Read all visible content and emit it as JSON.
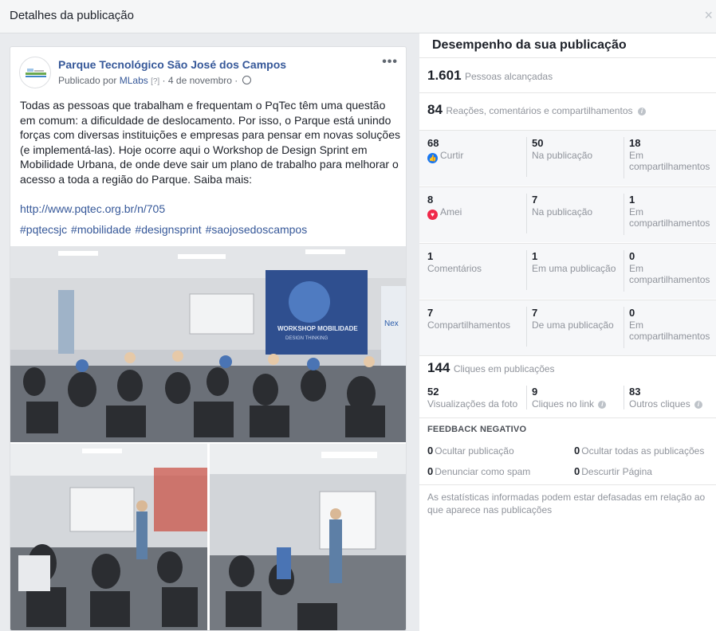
{
  "modal": {
    "title": "Detalhes da publicação",
    "close": "×"
  },
  "post": {
    "page_name": "Parque Tecnológico São José dos Campos",
    "meta_prefix": "Publicado por ",
    "publisher": "MLabs",
    "publisher_note": "[?]",
    "date": " · 4 de novembro · ",
    "more": "•••",
    "text": "Todas as pessoas que trabalham e frequentam o PqTec têm uma questão em comum: a dificuldade de deslocamento. Por isso, o Parque está unindo forças com diversas instituições e empresas para pensar em novas soluções (e implementá-las). Hoje ocorre aqui o Workshop de Design Sprint em Mobilidade Urbana, de onde deve sair um plano de trabalho para melhorar o acesso a toda a região do Parque. Saiba mais:",
    "link": "http://www.pqtec.org.br/n/705",
    "hashtags": "#pqtecsjc #mobilidade #designsprint #saojosedoscampos",
    "screen_text": "WORKSHOP MOBILIDADE",
    "screen_subtext": "DESIGN THINKING",
    "banner_text": "Nex"
  },
  "performance": {
    "title": "Desempenho da sua publicação",
    "reach": {
      "value": "1.601",
      "label": "Pessoas alcançadas"
    },
    "engagement": {
      "value": "84",
      "label": "Reações, comentários e compartilhamentos",
      "info": "i"
    },
    "rows": [
      {
        "total": "68",
        "total_label": "Curtir",
        "icon": "like-icon",
        "a": "50",
        "a_label": "Na publicação",
        "b": "18",
        "b_label": "Em compartilhamentos"
      },
      {
        "total": "8",
        "total_label": "Amei",
        "icon": "love-icon",
        "a": "7",
        "a_label": "Na publicação",
        "b": "1",
        "b_label": "Em compartilhamentos"
      },
      {
        "total": "1",
        "total_label": "Comentários",
        "a": "1",
        "a_label": "Em uma publicação",
        "b": "0",
        "b_label": "Em compartilhamentos"
      },
      {
        "total": "7",
        "total_label": "Compartilhamentos",
        "a": "7",
        "a_label": "De uma publicação",
        "b": "0",
        "b_label": "Em compartilhamentos"
      }
    ],
    "clicks": {
      "value": "144",
      "label": "Cliques em publicações",
      "photo_views": "52",
      "photo_views_label": "Visualizações da foto",
      "link_clicks": "9",
      "link_clicks_label": "Cliques no link",
      "other_clicks": "83",
      "other_clicks_label": "Outros cliques"
    },
    "negative": {
      "title": "FEEDBACK NEGATIVO",
      "hide_post": {
        "value": "0",
        "label": "Ocultar publicação"
      },
      "hide_all": {
        "value": "0",
        "label": "Ocultar todas as publicações"
      },
      "report_spam": {
        "value": "0",
        "label": "Denunciar como spam"
      },
      "unlike_page": {
        "value": "0",
        "label": "Descurtir Página"
      }
    },
    "footnote": "As estatísticas informadas podem estar defasadas em relação ao que aparece nas publicações"
  }
}
